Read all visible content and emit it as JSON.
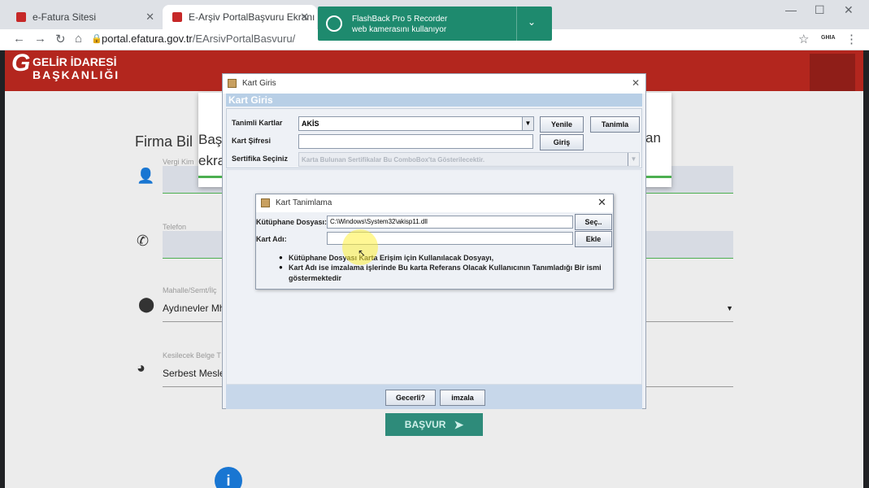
{
  "browser": {
    "tabs": [
      {
        "title": "e-Fatura Sitesi",
        "active": false
      },
      {
        "title": "E-Arşiv PortalBaşvuru Ekranı",
        "active": true
      }
    ],
    "url_host": "portal.efatura.gov.tr",
    "url_path": "/EArsivPortalBasvuru/",
    "profile_label": "GHIA"
  },
  "notification": {
    "app_name": "FlashBack Pro 5 Recorder",
    "message": "web kamerasını kullanıyor"
  },
  "site": {
    "logo_line1": "GELİR İDARESİ",
    "logo_line2": "BAŞKANLIĞI",
    "form_title": "Firma Bil",
    "popup_text_top": "Baş",
    "popup_text_bottom": "ekra",
    "popup_text_right": "an",
    "fields": [
      {
        "label": "Vergi Kim",
        "value": "",
        "icon": "person-icon"
      },
      {
        "label": "Telefon",
        "value": "",
        "icon": "phone-icon"
      },
      {
        "label": "Mahalle/Semt/İlç",
        "value": "Aydınevler Mh",
        "icon": "location-icon"
      },
      {
        "label": "Kesilecek Belge T",
        "value": "Serbest Mesle",
        "icon": "pie-icon"
      }
    ],
    "submit_label": "BAŞVUR",
    "info_symbol": "i"
  },
  "kart_giris": {
    "window_title": "Kart Giris",
    "banner": "Kart Giris",
    "tanimli_kartlar_label": "Tanimli Kartlar",
    "tanimli_kartlar_value": "AKİS",
    "kart_sifresi_label": "Kart Şifresi",
    "sertifika_label": "Sertifika Seçiniz",
    "sertifika_placeholder": "Karta Bulunan Sertifikalar Bu ComboBox'ta Gösterilecektir.",
    "yenile": "Yenile",
    "tanimla": "Tanimla",
    "giris": "Giriş",
    "gecerli": "Gecerli?",
    "imzala": "imzala"
  },
  "kart_tanimlama": {
    "window_title": "Kart Tanimlama",
    "kutuphane_label": "Kütüphane Dosyası:",
    "kutuphane_value": "C:\\Windows\\System32\\akisp11.dll",
    "kart_adi_label": "Kart Adı:",
    "kart_adi_value": "",
    "sec": "Seç..",
    "ekle": "Ekle",
    "bullet1": "Kütüphane Dosyası Karta Erişim için Kullanılacak Dosyayı,",
    "bullet2": "Kart Adı ise imzalama işlerinde Bu karta Referans Olacak Kullanıcının Tanımladığı Bir ismi",
    "bullet2_cont": "göstermektedir"
  },
  "colors": {
    "brand_red": "#b3261e",
    "accent_green": "#2e8b7a",
    "notification_green": "#1e8a6e"
  }
}
